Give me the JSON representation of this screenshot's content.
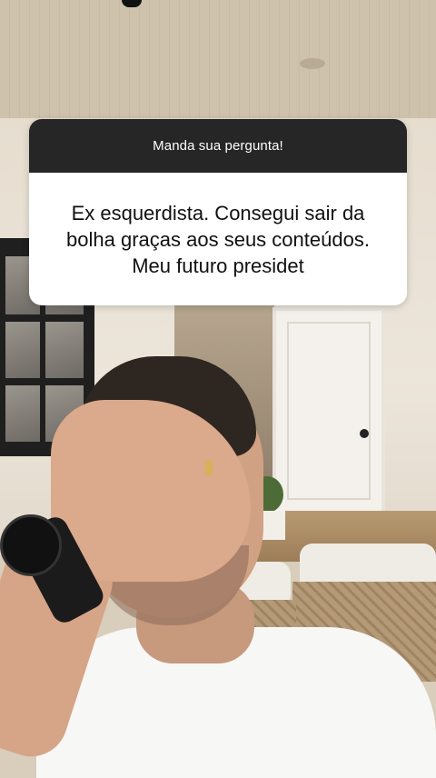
{
  "question_sticker": {
    "header": "Manda sua pergunta!",
    "text": "Ex esquerdista. Consegui sair da bolha graças aos seus conteúdos. Meu futuro presidet"
  },
  "colors": {
    "header_bg": "#262626",
    "body_bg": "#ffffff",
    "text_dark": "#111111"
  }
}
